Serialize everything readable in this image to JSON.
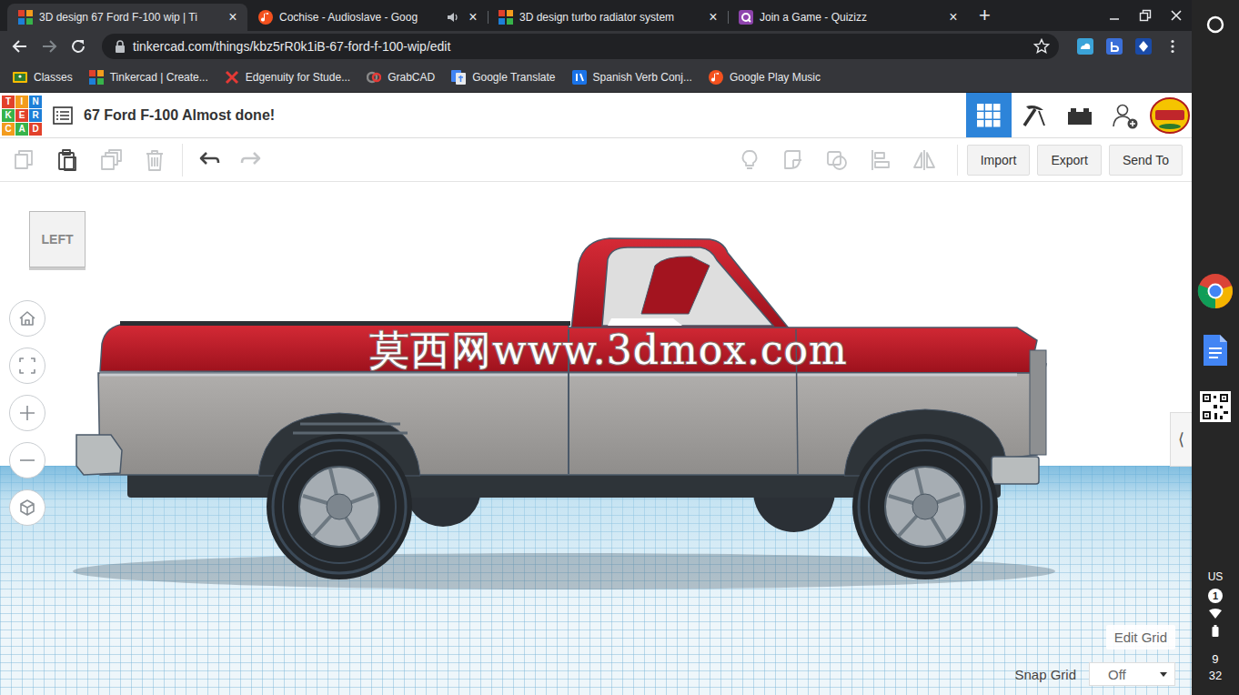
{
  "browser": {
    "tabs": [
      {
        "label": "3D design 67 Ford F-100 wip | Ti",
        "kind": "tinkercad",
        "selected": true,
        "audio": false
      },
      {
        "label": "Cochise - Audioslave - Goog",
        "kind": "music",
        "selected": false,
        "audio": true
      },
      {
        "label": "3D design turbo radiator system",
        "kind": "tinkercad",
        "selected": false,
        "audio": false
      },
      {
        "label": "Join a Game - Quizizz",
        "kind": "quizizz",
        "selected": false,
        "audio": false
      }
    ],
    "close_glyph": "×",
    "new_tab": "+",
    "url": "tinkercad.com/things/kbz5rR0k1iB-67-ford-f-100-wip/edit",
    "bookmarked": false,
    "bookmarks": [
      {
        "label": "Classes",
        "kind": "classroom"
      },
      {
        "label": "Tinkercad | Create...",
        "kind": "tinkercad"
      },
      {
        "label": "Edgenuity for Stude...",
        "kind": "edgenuity"
      },
      {
        "label": "GrabCAD",
        "kind": "grabcad"
      },
      {
        "label": "Google Translate",
        "kind": "translate"
      },
      {
        "label": "Spanish Verb Conj...",
        "kind": "spanishdict"
      },
      {
        "label": "Google Play Music",
        "kind": "music"
      }
    ]
  },
  "app": {
    "logo": [
      "T",
      "I",
      "N",
      "K",
      "E",
      "R",
      "C",
      "A",
      "D"
    ],
    "title": "67 Ford F-100 Almost done!",
    "views": [
      {
        "kind": "design",
        "selected": true
      },
      {
        "kind": "blocks",
        "selected": false
      },
      {
        "kind": "bricks",
        "selected": false
      }
    ]
  },
  "toolbar": {
    "edit_tools": [
      {
        "kind": "copy",
        "disabled": true
      },
      {
        "kind": "paste",
        "disabled": false
      },
      {
        "kind": "duplicate",
        "disabled": true
      },
      {
        "kind": "delete",
        "disabled": true
      },
      {
        "kind": "undo",
        "disabled": false
      },
      {
        "kind": "redo",
        "disabled": true
      }
    ],
    "view_tools": [
      {
        "kind": "notes",
        "disabled": true
      },
      {
        "kind": "group",
        "disabled": true
      },
      {
        "kind": "ungroup",
        "disabled": true
      },
      {
        "kind": "align",
        "disabled": true
      },
      {
        "kind": "mirror",
        "disabled": true
      }
    ],
    "buttons": [
      "Import",
      "Export",
      "Send To"
    ]
  },
  "canvas": {
    "view_cube": "LEFT",
    "nav": [
      {
        "kind": "home"
      },
      {
        "kind": "fit"
      },
      {
        "kind": "zoom-in"
      },
      {
        "kind": "zoom-out"
      },
      {
        "kind": "perspective"
      }
    ],
    "watermark": "莫西网www.3dmox.com",
    "panel_toggle": "⟨",
    "edit_grid": "Edit Grid",
    "snap_grid_label": "Snap Grid",
    "snap_grid_value": "Off"
  },
  "shelf": {
    "keyboard": "US",
    "notifications": "1",
    "hour": "9",
    "minute": "32"
  }
}
